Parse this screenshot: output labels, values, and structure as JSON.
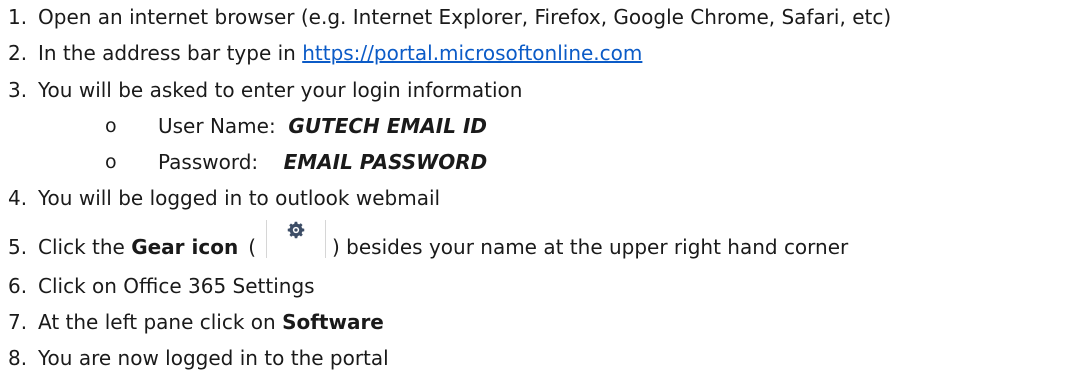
{
  "steps": [
    {
      "num": "1.",
      "text": "Open an internet browser (e.g. Internet Explorer, Firefox, Google Chrome, Safari, etc)"
    },
    {
      "num": "2.",
      "text": "In the address bar type in ",
      "link": "https://portal.microsoftonline.com"
    },
    {
      "num": "3.",
      "text": "You will be asked to enter your login information"
    },
    {
      "num": "4.",
      "text": "You will be logged in to outlook webmail"
    },
    {
      "num": "5.",
      "prefix": "Click the ",
      "bold": "Gear icon",
      "paren_open": "(",
      "paren_close": ")",
      "suffix": " besides your name at the upper right hand corner"
    },
    {
      "num": "6.",
      "text": "Click on Office 365 Settings"
    },
    {
      "num": "7.",
      "prefix": "At the left pane click on ",
      "bold": "Software"
    },
    {
      "num": "8.",
      "text": "You are now logged in to the portal"
    }
  ],
  "login_fields": [
    {
      "bullet": "o",
      "label": "User Name:  ",
      "value": "GUTECH EMAIL ID"
    },
    {
      "bullet": "o",
      "label": "Password:    ",
      "value": "EMAIL PASSWORD"
    }
  ],
  "icons": {
    "gear": "gear-icon"
  },
  "colors": {
    "link": "#0b5bc7",
    "gear": "#3d4d66"
  }
}
